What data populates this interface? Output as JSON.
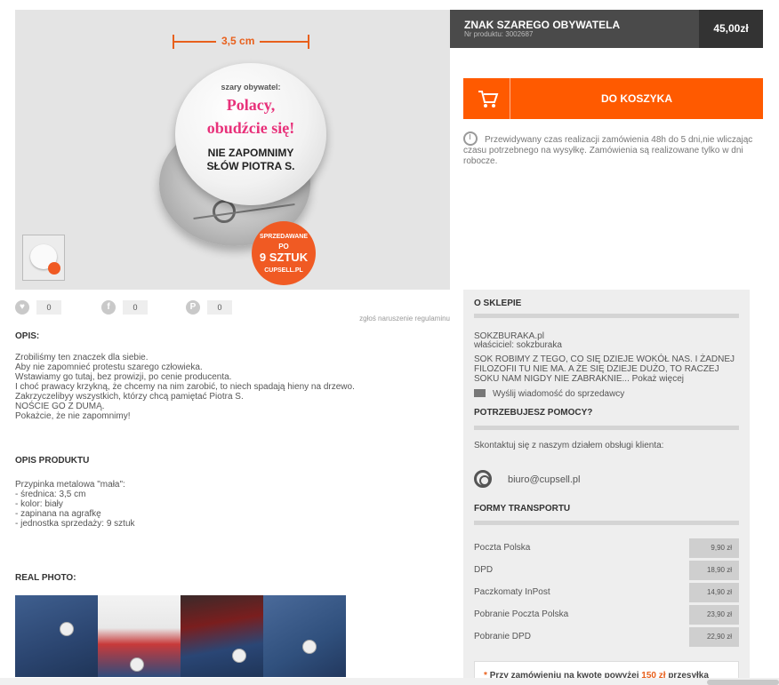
{
  "product_image": {
    "dimension_label": "3,5 cm",
    "badge_small": "szary obywatel:",
    "badge_pink_line1": "Polacy,",
    "badge_pink_line2": "obudźcie się!",
    "badge_black_line1": "NIE ZAPOMNIMY",
    "badge_black_line2": "SŁÓW PIOTRA S.",
    "sold_top": "SPRZEDAWANE",
    "sold_po": "PO",
    "sold_count": "9 SZTUK",
    "sold_site": "CUPSELL.PL"
  },
  "header": {
    "title": "ZNAK SZAREGO OBYWATELA",
    "product_number": "Nr produktu: 3002687",
    "price": "45,00zł"
  },
  "cart": {
    "label": "DO KOSZYKA"
  },
  "delivery_note": "Przewidywany czas realizacji zamówienia 48h do 5 dni,nie wliczając czasu potrzebnego na wysyłkę. Zamówienia są realizowane tylko w dni robocze.",
  "social": {
    "likes": "0",
    "facebook": "0",
    "pinterest": "0"
  },
  "report_link": "zgłoś naruszenie regulaminu",
  "description": {
    "heading": "OPIS:",
    "lines": [
      "Zrobiliśmy ten znaczek dla siebie.",
      "Aby nie zapomnieć protestu szarego człowieka.",
      "Wstawiamy go tutaj, bez prowizji, po cenie producenta.",
      "I choć prawacy krzykną, że chcemy na nim zarobić, to niech spadają hieny na drzewo.",
      "Zakrzyczelibyy wszystkich, którzy chcą pamiętać Piotra S.",
      "NOŚCIE GO Z DUMĄ.",
      "Pokażcie, że nie zapomnimy!"
    ]
  },
  "product_description": {
    "heading": "OPIS PRODUKTU",
    "lines": [
      "Przypinka metalowa \"mała\":",
      "- średnica: 3,5 cm",
      "- kolor: biały",
      "- zapinana na agrafkę",
      "- jednostka sprzedaży: 9 sztuk"
    ]
  },
  "real_photo": {
    "heading": "REAL PHOTO:"
  },
  "shop": {
    "heading": "O SKLEPIE",
    "name": "SOKZBURAKA.pl",
    "owner": "właściciel: sokzburaka",
    "motto": "SOK ROBIMY Z TEGO, CO SIĘ DZIEJE WOKÓŁ NAS. I ŻADNEJ FILOZOFII TU NIE MA. A ŻE SIĘ DZIEJE DUŻO, TO RACZEJ SOKU NAM NIGDY NIE ZABRAKNIE...",
    "show_more": "Pokaż więcej",
    "message_link": "Wyślij wiadomość do sprzedawcy",
    "help_heading": "POTRZEBUJESZ POMOCY?",
    "help_text": "Skontaktuj się z naszym działem obsługi klienta:",
    "email": "biuro@cupsell.pl",
    "transport_heading": "FORMY TRANSPORTU",
    "shipping": [
      {
        "name": "Poczta Polska",
        "price": "9,90 zł"
      },
      {
        "name": "DPD",
        "price": "18,90 zł"
      },
      {
        "name": "Paczkomaty InPost",
        "price": "14,90 zł"
      },
      {
        "name": "Pobranie Poczta Polska",
        "price": "23,90 zł"
      },
      {
        "name": "Pobranie DPD",
        "price": "22,90 zł"
      }
    ],
    "promo_prefix": "Przy zamówieniu na kwotę powyżej",
    "promo_amount": "150 zł",
    "promo_suffix": "przesyłka"
  },
  "colors": {
    "accent": "#ff5a00",
    "header_bg": "#4a4a4a",
    "panel_bg": "#eeeeee"
  }
}
